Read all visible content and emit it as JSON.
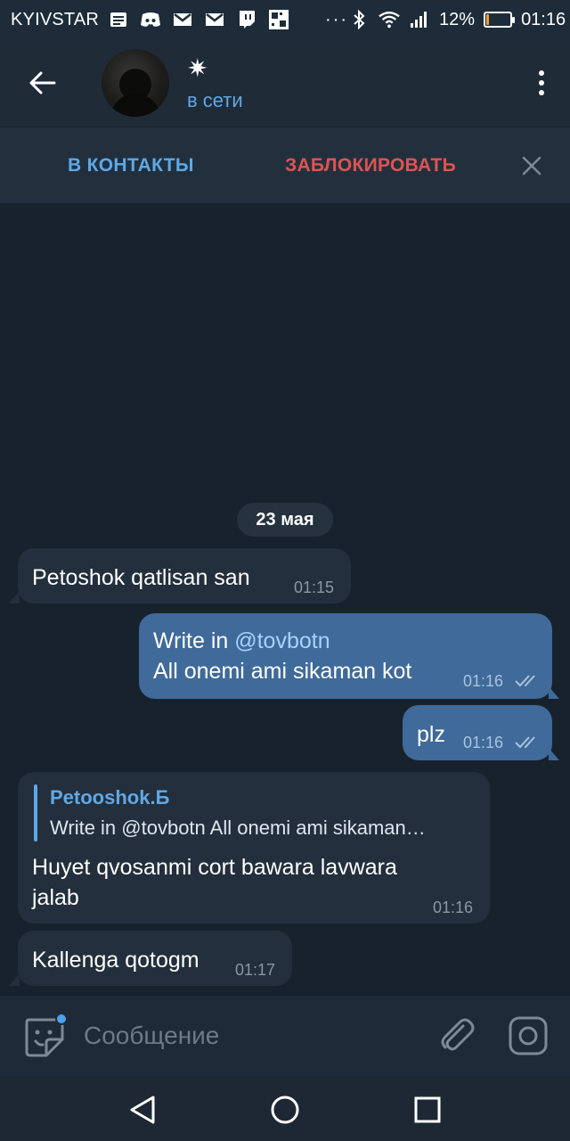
{
  "status_bar": {
    "carrier": "KYIVSTAR",
    "more": "···",
    "battery_percent": "12%",
    "battery_level": 0.12,
    "time": "01:16",
    "icons": [
      "notes-icon",
      "discord-icon",
      "gmail-icon",
      "gmail-icon",
      "twitch-icon",
      "grid-app-icon",
      "bluetooth-icon",
      "wifi-icon",
      "signal-icon",
      "battery-icon"
    ]
  },
  "header": {
    "name": "✷",
    "status": "в сети"
  },
  "actions": {
    "add_contact": "В КОНТАКТЫ",
    "block": "ЗАБЛОКИРОВАТЬ"
  },
  "chat": {
    "date": "23 мая",
    "messages": [
      {
        "direction": "in",
        "text": "Petoshok qatlisan san",
        "time": "01:15"
      },
      {
        "direction": "out",
        "line1_prefix": "Write in ",
        "mention": "@tovbotn",
        "line2": "All onemi ami sikaman kot",
        "time": "01:16",
        "status": "read"
      },
      {
        "direction": "out",
        "text": "plz",
        "time": "01:16",
        "status": "read"
      },
      {
        "direction": "in",
        "reply_name": "Petooshok.Б",
        "reply_text": "Write in @tovbotn  All onemi ami sikaman…",
        "line1": "Huyet qvosanmi cort bawara lavwara",
        "line2": "jalab",
        "time": "01:16"
      },
      {
        "direction": "in",
        "text": "Kallenga qotogm",
        "time": "01:17"
      }
    ]
  },
  "composer": {
    "placeholder": "Сообщение"
  },
  "colors": {
    "accent": "#5fa8e6",
    "danger": "#e05353",
    "bubble_in": "#232f3c",
    "bubble_out": "#3f6a99",
    "background": "#18222d"
  }
}
